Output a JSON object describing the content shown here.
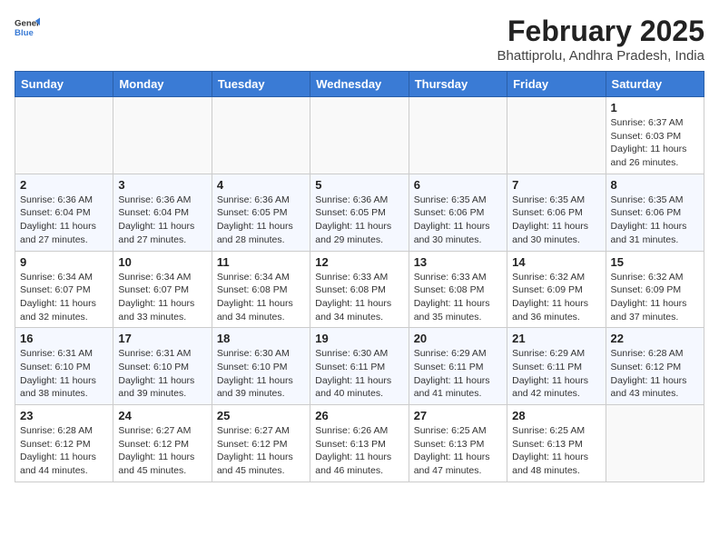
{
  "header": {
    "logo_general": "General",
    "logo_blue": "Blue",
    "month_year": "February 2025",
    "location": "Bhattiprolu, Andhra Pradesh, India"
  },
  "weekdays": [
    "Sunday",
    "Monday",
    "Tuesday",
    "Wednesday",
    "Thursday",
    "Friday",
    "Saturday"
  ],
  "weeks": [
    [
      {
        "day": "",
        "info": ""
      },
      {
        "day": "",
        "info": ""
      },
      {
        "day": "",
        "info": ""
      },
      {
        "day": "",
        "info": ""
      },
      {
        "day": "",
        "info": ""
      },
      {
        "day": "",
        "info": ""
      },
      {
        "day": "1",
        "info": "Sunrise: 6:37 AM\nSunset: 6:03 PM\nDaylight: 11 hours and 26 minutes."
      }
    ],
    [
      {
        "day": "2",
        "info": "Sunrise: 6:36 AM\nSunset: 6:04 PM\nDaylight: 11 hours and 27 minutes."
      },
      {
        "day": "3",
        "info": "Sunrise: 6:36 AM\nSunset: 6:04 PM\nDaylight: 11 hours and 27 minutes."
      },
      {
        "day": "4",
        "info": "Sunrise: 6:36 AM\nSunset: 6:05 PM\nDaylight: 11 hours and 28 minutes."
      },
      {
        "day": "5",
        "info": "Sunrise: 6:36 AM\nSunset: 6:05 PM\nDaylight: 11 hours and 29 minutes."
      },
      {
        "day": "6",
        "info": "Sunrise: 6:35 AM\nSunset: 6:06 PM\nDaylight: 11 hours and 30 minutes."
      },
      {
        "day": "7",
        "info": "Sunrise: 6:35 AM\nSunset: 6:06 PM\nDaylight: 11 hours and 30 minutes."
      },
      {
        "day": "8",
        "info": "Sunrise: 6:35 AM\nSunset: 6:06 PM\nDaylight: 11 hours and 31 minutes."
      }
    ],
    [
      {
        "day": "9",
        "info": "Sunrise: 6:34 AM\nSunset: 6:07 PM\nDaylight: 11 hours and 32 minutes."
      },
      {
        "day": "10",
        "info": "Sunrise: 6:34 AM\nSunset: 6:07 PM\nDaylight: 11 hours and 33 minutes."
      },
      {
        "day": "11",
        "info": "Sunrise: 6:34 AM\nSunset: 6:08 PM\nDaylight: 11 hours and 34 minutes."
      },
      {
        "day": "12",
        "info": "Sunrise: 6:33 AM\nSunset: 6:08 PM\nDaylight: 11 hours and 34 minutes."
      },
      {
        "day": "13",
        "info": "Sunrise: 6:33 AM\nSunset: 6:08 PM\nDaylight: 11 hours and 35 minutes."
      },
      {
        "day": "14",
        "info": "Sunrise: 6:32 AM\nSunset: 6:09 PM\nDaylight: 11 hours and 36 minutes."
      },
      {
        "day": "15",
        "info": "Sunrise: 6:32 AM\nSunset: 6:09 PM\nDaylight: 11 hours and 37 minutes."
      }
    ],
    [
      {
        "day": "16",
        "info": "Sunrise: 6:31 AM\nSunset: 6:10 PM\nDaylight: 11 hours and 38 minutes."
      },
      {
        "day": "17",
        "info": "Sunrise: 6:31 AM\nSunset: 6:10 PM\nDaylight: 11 hours and 39 minutes."
      },
      {
        "day": "18",
        "info": "Sunrise: 6:30 AM\nSunset: 6:10 PM\nDaylight: 11 hours and 39 minutes."
      },
      {
        "day": "19",
        "info": "Sunrise: 6:30 AM\nSunset: 6:11 PM\nDaylight: 11 hours and 40 minutes."
      },
      {
        "day": "20",
        "info": "Sunrise: 6:29 AM\nSunset: 6:11 PM\nDaylight: 11 hours and 41 minutes."
      },
      {
        "day": "21",
        "info": "Sunrise: 6:29 AM\nSunset: 6:11 PM\nDaylight: 11 hours and 42 minutes."
      },
      {
        "day": "22",
        "info": "Sunrise: 6:28 AM\nSunset: 6:12 PM\nDaylight: 11 hours and 43 minutes."
      }
    ],
    [
      {
        "day": "23",
        "info": "Sunrise: 6:28 AM\nSunset: 6:12 PM\nDaylight: 11 hours and 44 minutes."
      },
      {
        "day": "24",
        "info": "Sunrise: 6:27 AM\nSunset: 6:12 PM\nDaylight: 11 hours and 45 minutes."
      },
      {
        "day": "25",
        "info": "Sunrise: 6:27 AM\nSunset: 6:12 PM\nDaylight: 11 hours and 45 minutes."
      },
      {
        "day": "26",
        "info": "Sunrise: 6:26 AM\nSunset: 6:13 PM\nDaylight: 11 hours and 46 minutes."
      },
      {
        "day": "27",
        "info": "Sunrise: 6:25 AM\nSunset: 6:13 PM\nDaylight: 11 hours and 47 minutes."
      },
      {
        "day": "28",
        "info": "Sunrise: 6:25 AM\nSunset: 6:13 PM\nDaylight: 11 hours and 48 minutes."
      },
      {
        "day": "",
        "info": ""
      }
    ]
  ]
}
